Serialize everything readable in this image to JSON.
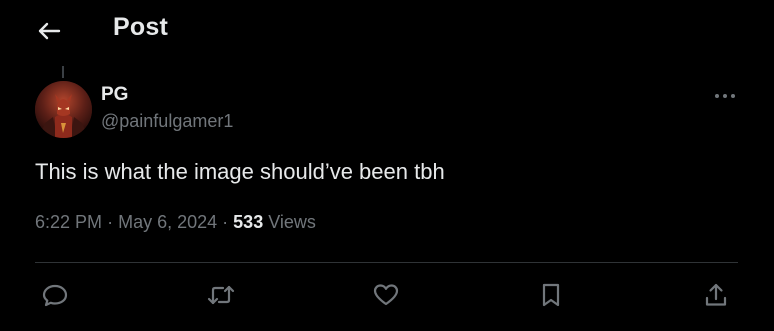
{
  "header": {
    "title": "Post",
    "back_icon": "arrow-left-icon"
  },
  "post": {
    "author_name": "PG",
    "author_handle": "@painfulgamer1",
    "text": "This is what the image should’ve been tbh",
    "time": "6:22 PM",
    "date": "May 6, 2024",
    "views_count": "533",
    "views_label": "Views",
    "separator": "·"
  },
  "actions": [
    {
      "name": "reply",
      "icon": "reply-icon"
    },
    {
      "name": "repost",
      "icon": "repost-icon"
    },
    {
      "name": "like",
      "icon": "heart-icon"
    },
    {
      "name": "bookmark",
      "icon": "bookmark-icon"
    },
    {
      "name": "share",
      "icon": "share-icon"
    }
  ],
  "colors": {
    "background": "#000000",
    "primary_text": "#e7e9ea",
    "secondary_text": "#71767b",
    "divider": "#2f3336"
  }
}
